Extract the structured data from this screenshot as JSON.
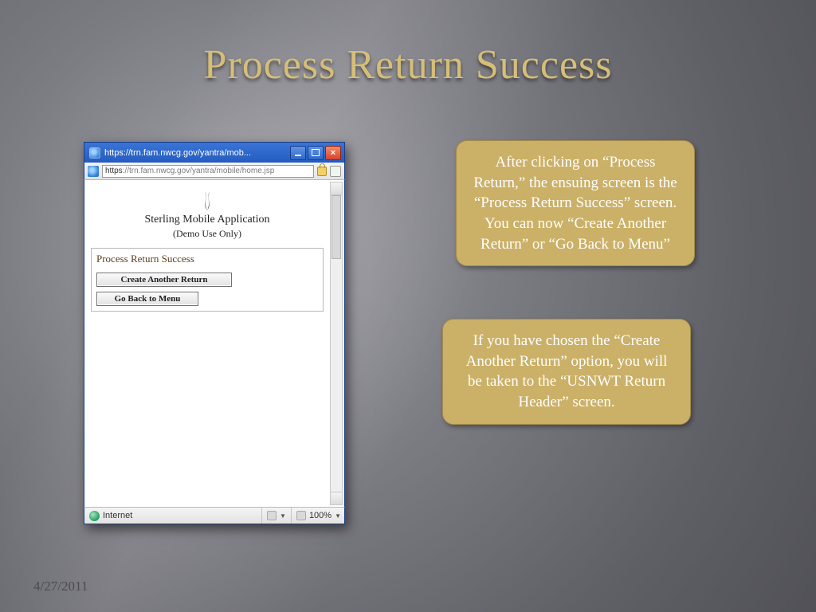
{
  "slide": {
    "title": "Process Return Success",
    "date": "4/27/2011"
  },
  "callouts": {
    "first": "After clicking on “Process Return,” the ensuing screen is the “Process Return Success” screen. You can now “Create Another Return” or “Go Back to Menu”",
    "second": "If you have chosen the “Create Another Return” option, you will be taken to the “USNWT Return Header” screen."
  },
  "window": {
    "title": "https://trn.fam.nwcg.gov/yantra/mob...",
    "address_proto": "https",
    "address_rest": "://trn.fam.nwcg.gov/yantra/mobile/home.jsp",
    "app_name": "Sterling Mobile Application",
    "app_sub": "(Demo Use Only)",
    "panel_title": "Process Return Success",
    "button1": "Create Another Return",
    "button2": "Go Back to Menu",
    "status_zone": "Internet",
    "zoom": "100%"
  }
}
